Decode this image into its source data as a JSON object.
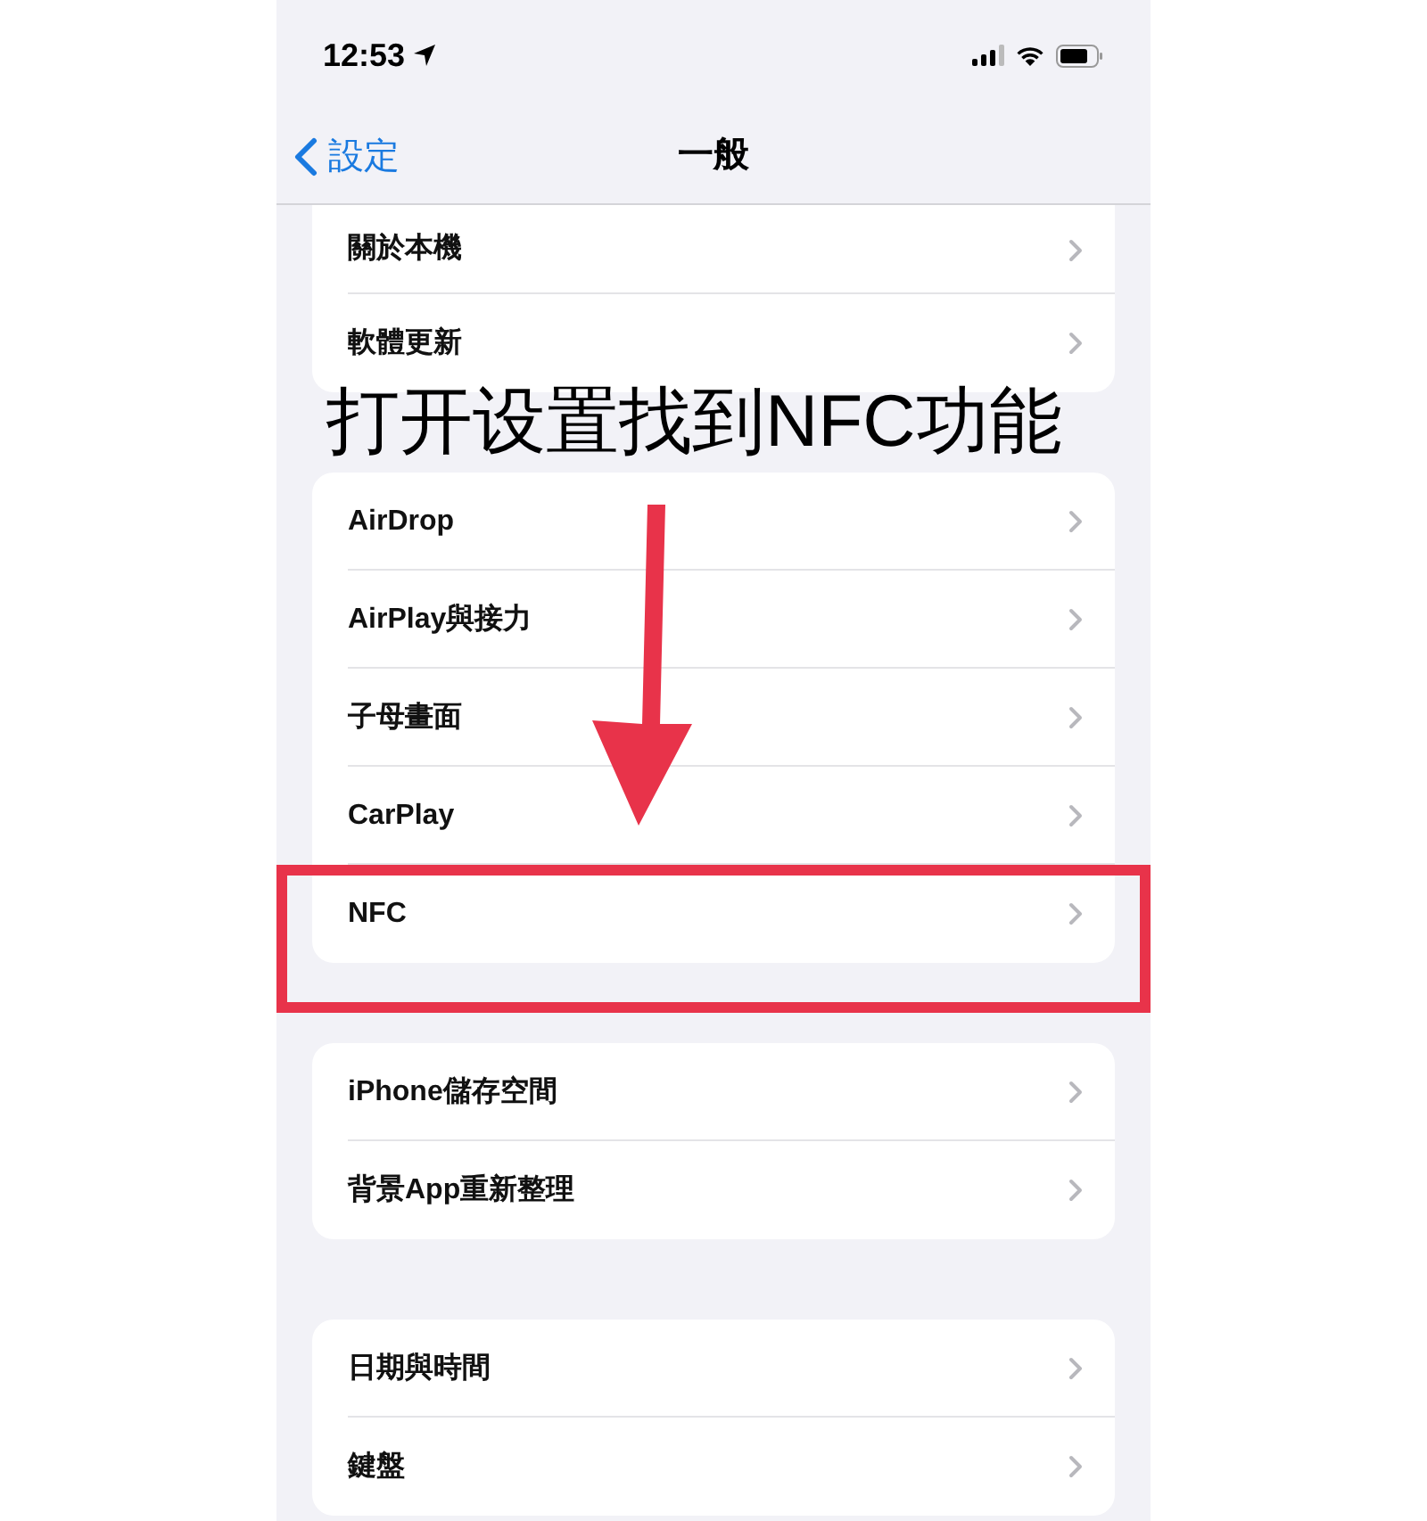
{
  "status_bar": {
    "time": "12:53"
  },
  "nav": {
    "back_label": "設定",
    "title": "一般"
  },
  "groups": [
    {
      "items": [
        {
          "label": "關於本機",
          "highlighted": false
        },
        {
          "label": "軟體更新",
          "highlighted": false
        }
      ]
    },
    {
      "items": [
        {
          "label": "AirDrop",
          "highlighted": false
        },
        {
          "label": "AirPlay與接力",
          "highlighted": false
        },
        {
          "label": "子母畫面",
          "highlighted": false
        },
        {
          "label": "CarPlay",
          "highlighted": false
        },
        {
          "label": "NFC",
          "highlighted": true
        }
      ]
    },
    {
      "items": [
        {
          "label": "iPhone儲存空間",
          "highlighted": false
        },
        {
          "label": "背景App重新整理",
          "highlighted": false
        }
      ]
    },
    {
      "items": [
        {
          "label": "日期與時間",
          "highlighted": false
        },
        {
          "label": "鍵盤",
          "highlighted": false
        }
      ]
    }
  ],
  "annotation": {
    "caption": "打开设置找到NFC功能"
  }
}
